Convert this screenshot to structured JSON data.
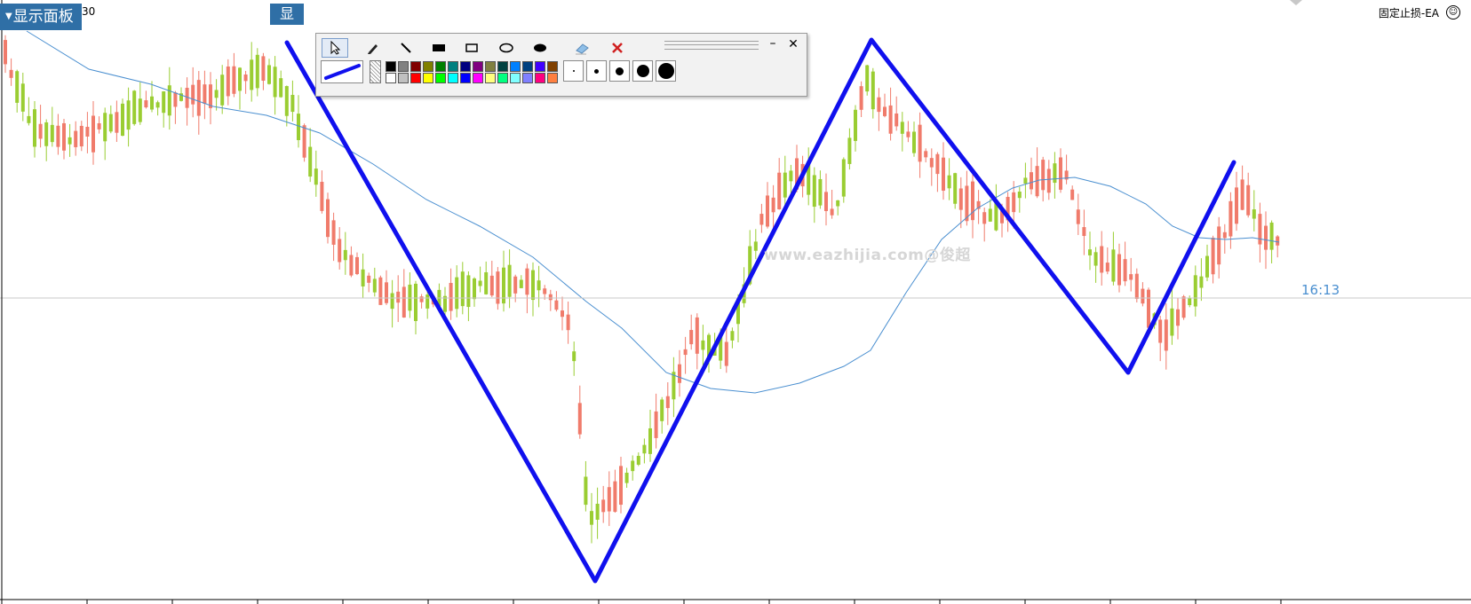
{
  "header": {
    "panel_button": "显示面板",
    "panel_arrow": "▼",
    "top_digits": "30",
    "xian_button": "显",
    "ea_label": "固定止损-EA",
    "smile": "☺"
  },
  "chart": {
    "time_label": "16:13",
    "watermark": "www.eazhijia.com@俊超",
    "bull_color": "#f07b6b",
    "bear_color": "#9acd32",
    "ma_color": "#4a8fd0",
    "zigzag_color": "#1010ee"
  },
  "toolbar": {
    "tools": [
      "select-arrow-icon",
      "pencil-icon",
      "line-icon",
      "filled-rect-icon",
      "rect-icon",
      "ellipse-icon",
      "filled-ellipse-icon",
      "eraser-icon",
      "delete-icon"
    ],
    "minimize_label": "–",
    "close_label": "✕",
    "palette_top": [
      "#000000",
      "#808080",
      "#800000",
      "#808000",
      "#008000",
      "#008080",
      "#000080",
      "#800080",
      "#808040",
      "#004040",
      "#0080ff",
      "#004080",
      "#4000ff",
      "#804000"
    ],
    "palette_bottom": [
      "#ffffff",
      "#c0c0c0",
      "#ff0000",
      "#ffff00",
      "#00ff00",
      "#00ffff",
      "#0000ff",
      "#ff00ff",
      "#ffff80",
      "#00ff80",
      "#80ffff",
      "#8080ff",
      "#ff0080",
      "#ff8040"
    ],
    "dot_sizes": [
      2,
      5,
      9,
      14,
      18
    ]
  }
}
